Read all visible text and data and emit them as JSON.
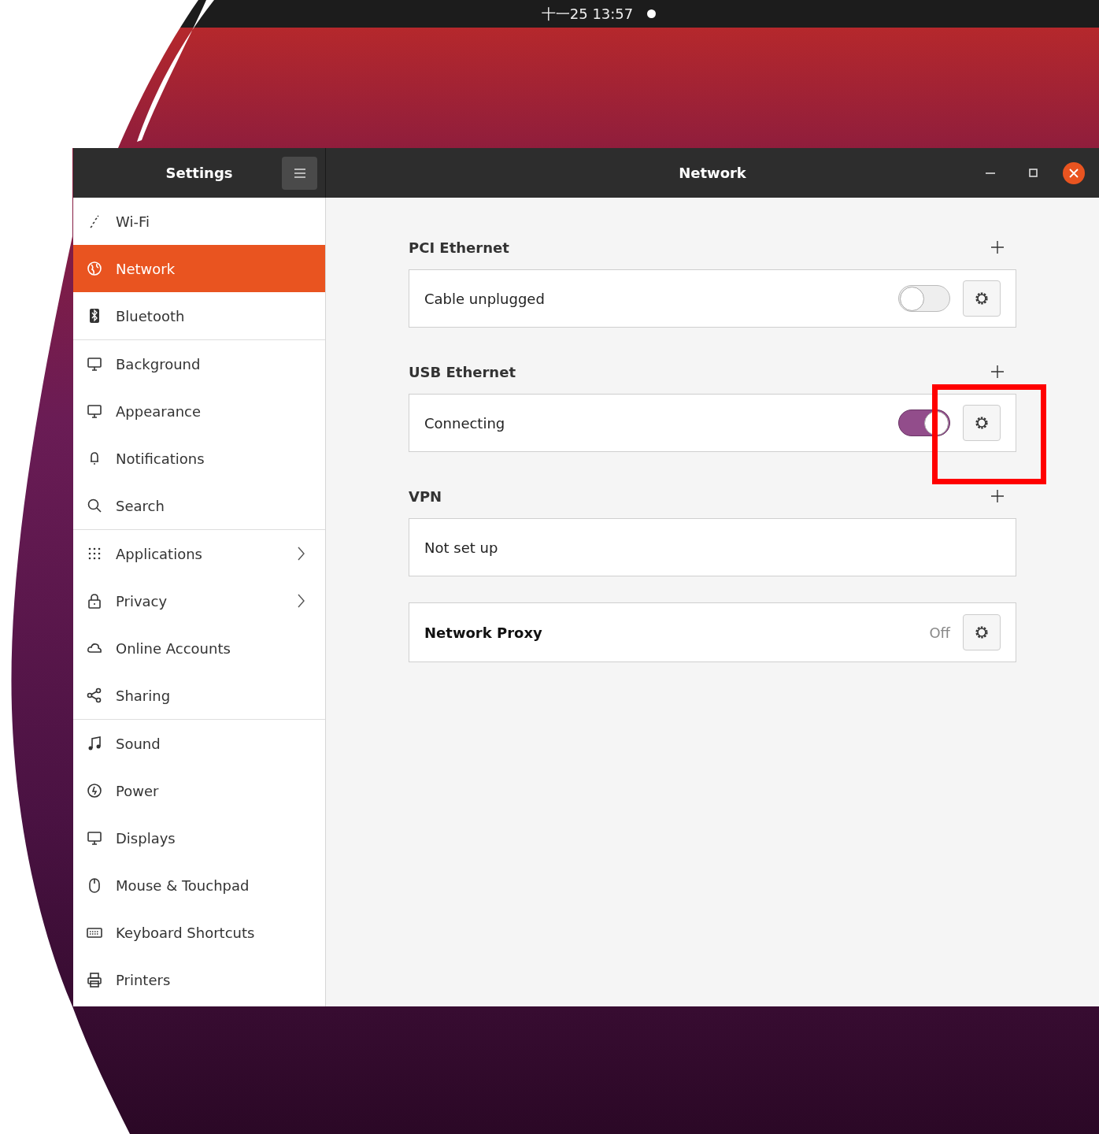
{
  "top_bar": {
    "clock": "十一25 13:57"
  },
  "window": {
    "sidebar_title": "Settings",
    "title": "Network"
  },
  "sidebar": {
    "groups": [
      [
        {
          "label": "Wi-Fi",
          "kind": "wifi",
          "selected": false,
          "arrow": false
        },
        {
          "label": "Network",
          "kind": "globe",
          "selected": true,
          "arrow": false
        },
        {
          "label": "Bluetooth",
          "kind": "bluetooth",
          "selected": false,
          "arrow": false
        }
      ],
      [
        {
          "label": "Background",
          "kind": "monitor",
          "selected": false,
          "arrow": false
        },
        {
          "label": "Appearance",
          "kind": "monitor",
          "selected": false,
          "arrow": false
        },
        {
          "label": "Notifications",
          "kind": "bell",
          "selected": false,
          "arrow": false
        },
        {
          "label": "Search",
          "kind": "search",
          "selected": false,
          "arrow": false
        }
      ],
      [
        {
          "label": "Applications",
          "kind": "grid",
          "selected": false,
          "arrow": true
        },
        {
          "label": "Privacy",
          "kind": "lock",
          "selected": false,
          "arrow": true
        },
        {
          "label": "Online Accounts",
          "kind": "cloud",
          "selected": false,
          "arrow": false
        },
        {
          "label": "Sharing",
          "kind": "share",
          "selected": false,
          "arrow": false
        }
      ],
      [
        {
          "label": "Sound",
          "kind": "note",
          "selected": false,
          "arrow": false
        },
        {
          "label": "Power",
          "kind": "power",
          "selected": false,
          "arrow": false
        },
        {
          "label": "Displays",
          "kind": "monitor",
          "selected": false,
          "arrow": false
        },
        {
          "label": "Mouse & Touchpad",
          "kind": "mouse",
          "selected": false,
          "arrow": false
        },
        {
          "label": "Keyboard Shortcuts",
          "kind": "keyboard",
          "selected": false,
          "arrow": false
        },
        {
          "label": "Printers",
          "kind": "printer",
          "selected": false,
          "arrow": false
        }
      ]
    ]
  },
  "sections": [
    {
      "title": "PCI Ethernet",
      "rows": [
        {
          "kind": "device",
          "label": "Cable unplugged",
          "on": false
        }
      ]
    },
    {
      "title": "USB Ethernet",
      "rows": [
        {
          "kind": "device",
          "label": "Connecting",
          "on": true
        }
      ]
    },
    {
      "title": "VPN",
      "rows": [
        {
          "kind": "empty",
          "label": "Not set up"
        }
      ]
    }
  ],
  "proxy": {
    "label": "Network Proxy",
    "status": "Off"
  }
}
